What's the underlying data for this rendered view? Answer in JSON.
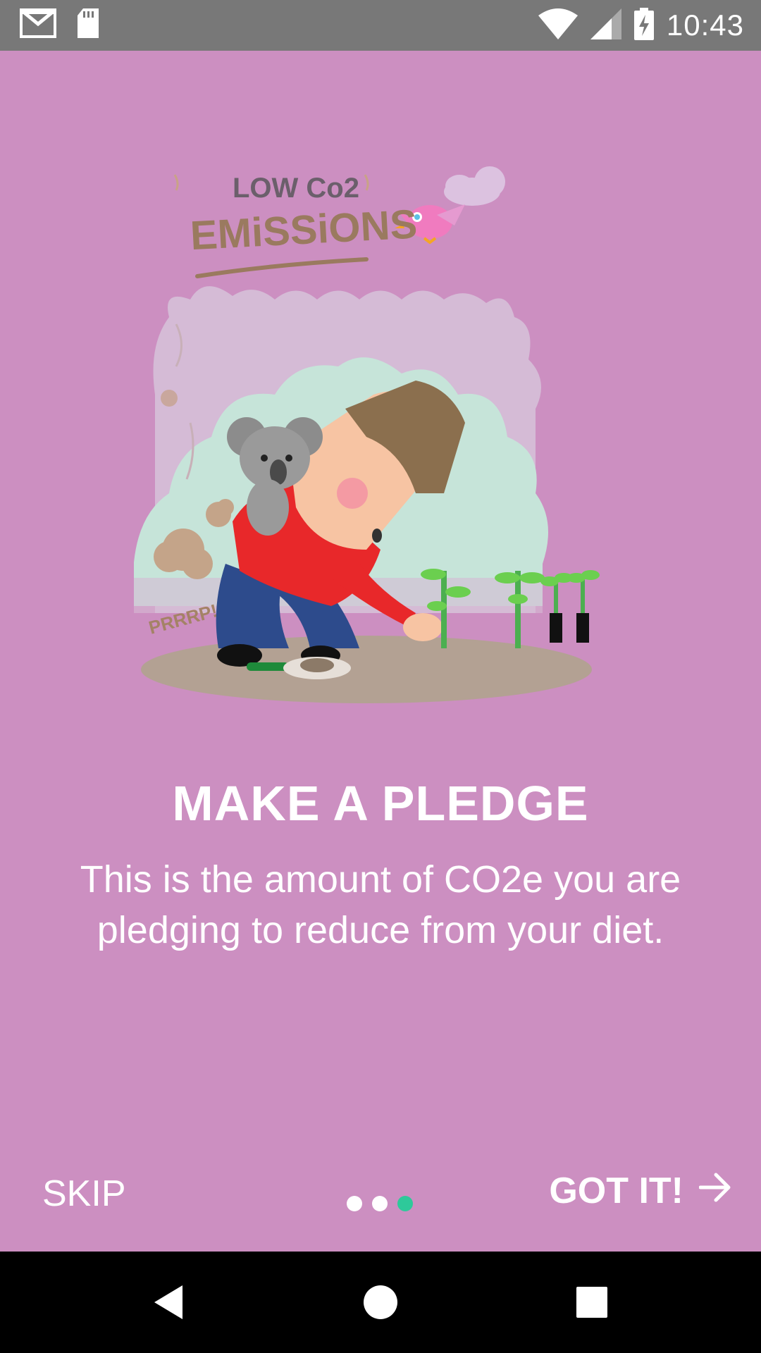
{
  "status_bar": {
    "time": "10:43",
    "icons": [
      "gmail-icon",
      "sd-card-icon",
      "wifi-icon",
      "signal-icon",
      "battery-charging-icon"
    ]
  },
  "illustration": {
    "headline_small": "LOW Co2",
    "headline_large": "EMiSSiONS",
    "sound_text": "PRRRP!"
  },
  "onboarding": {
    "title": "MAKE A PLEDGE",
    "description": "This is the amount of CO2e you are pledging to reduce from your diet."
  },
  "controls": {
    "skip_label": "SKIP",
    "gotit_label": "GOT IT!",
    "page_count": 3,
    "active_page": 3
  },
  "colors": {
    "background": "#cc8fc1",
    "dot_inactive": "#ffffff",
    "dot_active": "#2ec99a",
    "status_bar": "#787878",
    "nav_bar": "#000000"
  },
  "nav_bar": {
    "icons": [
      "back-icon",
      "home-icon",
      "recents-icon"
    ]
  }
}
